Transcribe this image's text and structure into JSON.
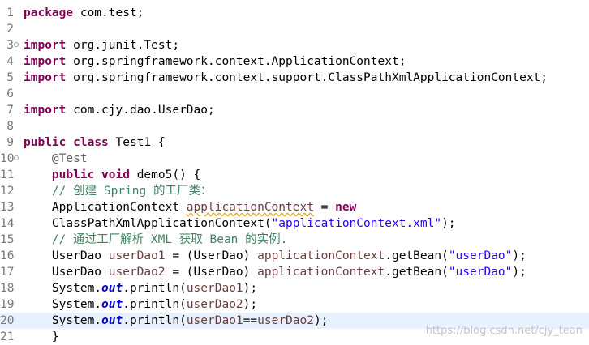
{
  "editor": {
    "lines": [
      {
        "num": "1",
        "indent": "",
        "tokens": [
          {
            "t": "package",
            "c": "kw"
          },
          {
            "t": " com.test;"
          }
        ]
      },
      {
        "num": "2",
        "indent": "",
        "tokens": []
      },
      {
        "num": "3",
        "fold": true,
        "indent": "",
        "tokens": [
          {
            "t": "import",
            "c": "kw"
          },
          {
            "t": " org.junit.Test;"
          }
        ]
      },
      {
        "num": "4",
        "indent": "",
        "tokens": [
          {
            "t": "import",
            "c": "kw"
          },
          {
            "t": " org.springframework.context.ApplicationContext;"
          }
        ]
      },
      {
        "num": "5",
        "indent": "",
        "tokens": [
          {
            "t": "import",
            "c": "kw"
          },
          {
            "t": " org.springframework.context.support.ClassPathXmlApplicationContext;"
          }
        ]
      },
      {
        "num": "6",
        "indent": "",
        "tokens": []
      },
      {
        "num": "7",
        "indent": "",
        "tokens": [
          {
            "t": "import",
            "c": "kw"
          },
          {
            "t": " com.cjy.dao.UserDao;"
          }
        ]
      },
      {
        "num": "8",
        "indent": "",
        "tokens": []
      },
      {
        "num": "9",
        "indent": "",
        "tokens": [
          {
            "t": "public",
            "c": "kw"
          },
          {
            "t": " "
          },
          {
            "t": "class",
            "c": "kw"
          },
          {
            "t": " Test1 {"
          }
        ]
      },
      {
        "num": "10",
        "fold": true,
        "indent": "    ",
        "tokens": [
          {
            "t": "@Test",
            "c": "ann"
          }
        ]
      },
      {
        "num": "11",
        "indent": "    ",
        "tokens": [
          {
            "t": "public",
            "c": "kw"
          },
          {
            "t": " "
          },
          {
            "t": "void",
            "c": "kw"
          },
          {
            "t": " demo5() {"
          }
        ]
      },
      {
        "num": "12",
        "indent": "    ",
        "tokens": [
          {
            "t": "// 创建 Spring 的工厂类：",
            "c": "cmt"
          }
        ]
      },
      {
        "num": "13",
        "indent": "    ",
        "tokens": [
          {
            "t": "ApplicationContext "
          },
          {
            "t": "applicationContext",
            "c": "var warn"
          },
          {
            "t": " = "
          },
          {
            "t": "new",
            "c": "kw"
          }
        ]
      },
      {
        "num": "14",
        "indent": "    ",
        "tokens": [
          {
            "t": "ClassPathXmlApplicationContext("
          },
          {
            "t": "\"applicationContext.xml\"",
            "c": "str"
          },
          {
            "t": ");"
          }
        ]
      },
      {
        "num": "15",
        "indent": "    ",
        "tokens": [
          {
            "t": "// 通过工厂解析 XML 获取 Bean 的实例.",
            "c": "cmt"
          }
        ]
      },
      {
        "num": "16",
        "indent": "    ",
        "tokens": [
          {
            "t": "UserDao "
          },
          {
            "t": "userDao1",
            "c": "var"
          },
          {
            "t": " = (UserDao) "
          },
          {
            "t": "applicationContext",
            "c": "var"
          },
          {
            "t": ".getBean("
          },
          {
            "t": "\"userDao\"",
            "c": "str"
          },
          {
            "t": ");"
          }
        ]
      },
      {
        "num": "17",
        "indent": "    ",
        "tokens": [
          {
            "t": "UserDao "
          },
          {
            "t": "userDao2",
            "c": "var"
          },
          {
            "t": " = (UserDao) "
          },
          {
            "t": "applicationContext",
            "c": "var"
          },
          {
            "t": ".getBean("
          },
          {
            "t": "\"userDao\"",
            "c": "str"
          },
          {
            "t": ");"
          }
        ]
      },
      {
        "num": "18",
        "indent": "    ",
        "tokens": [
          {
            "t": "System."
          },
          {
            "t": "out",
            "c": "fld"
          },
          {
            "t": ".println("
          },
          {
            "t": "userDao1",
            "c": "var"
          },
          {
            "t": ");"
          }
        ]
      },
      {
        "num": "19",
        "indent": "    ",
        "tokens": [
          {
            "t": "System."
          },
          {
            "t": "out",
            "c": "fld"
          },
          {
            "t": ".println("
          },
          {
            "t": "userDao2",
            "c": "var"
          },
          {
            "t": ");"
          }
        ]
      },
      {
        "num": "20",
        "current": true,
        "indent": "    ",
        "tokens": [
          {
            "t": "System."
          },
          {
            "t": "out",
            "c": "fld"
          },
          {
            "t": ".println("
          },
          {
            "t": "userDao1",
            "c": "var"
          },
          {
            "t": "=="
          },
          {
            "t": "userDao2",
            "c": "var"
          },
          {
            "t": ");"
          }
        ]
      },
      {
        "num": "21",
        "indent": "    ",
        "tokens": [
          {
            "t": "}"
          }
        ]
      }
    ]
  },
  "watermark": "https://blog.csdn.net/cjy_tean",
  "colors": {
    "keyword": "#7f0055",
    "comment": "#3f7f5f",
    "string": "#2a00ff",
    "local_variable": "#6a3e3e",
    "static_field": "#0000c0",
    "annotation": "#646464",
    "current_line": "#e8f2fe"
  }
}
